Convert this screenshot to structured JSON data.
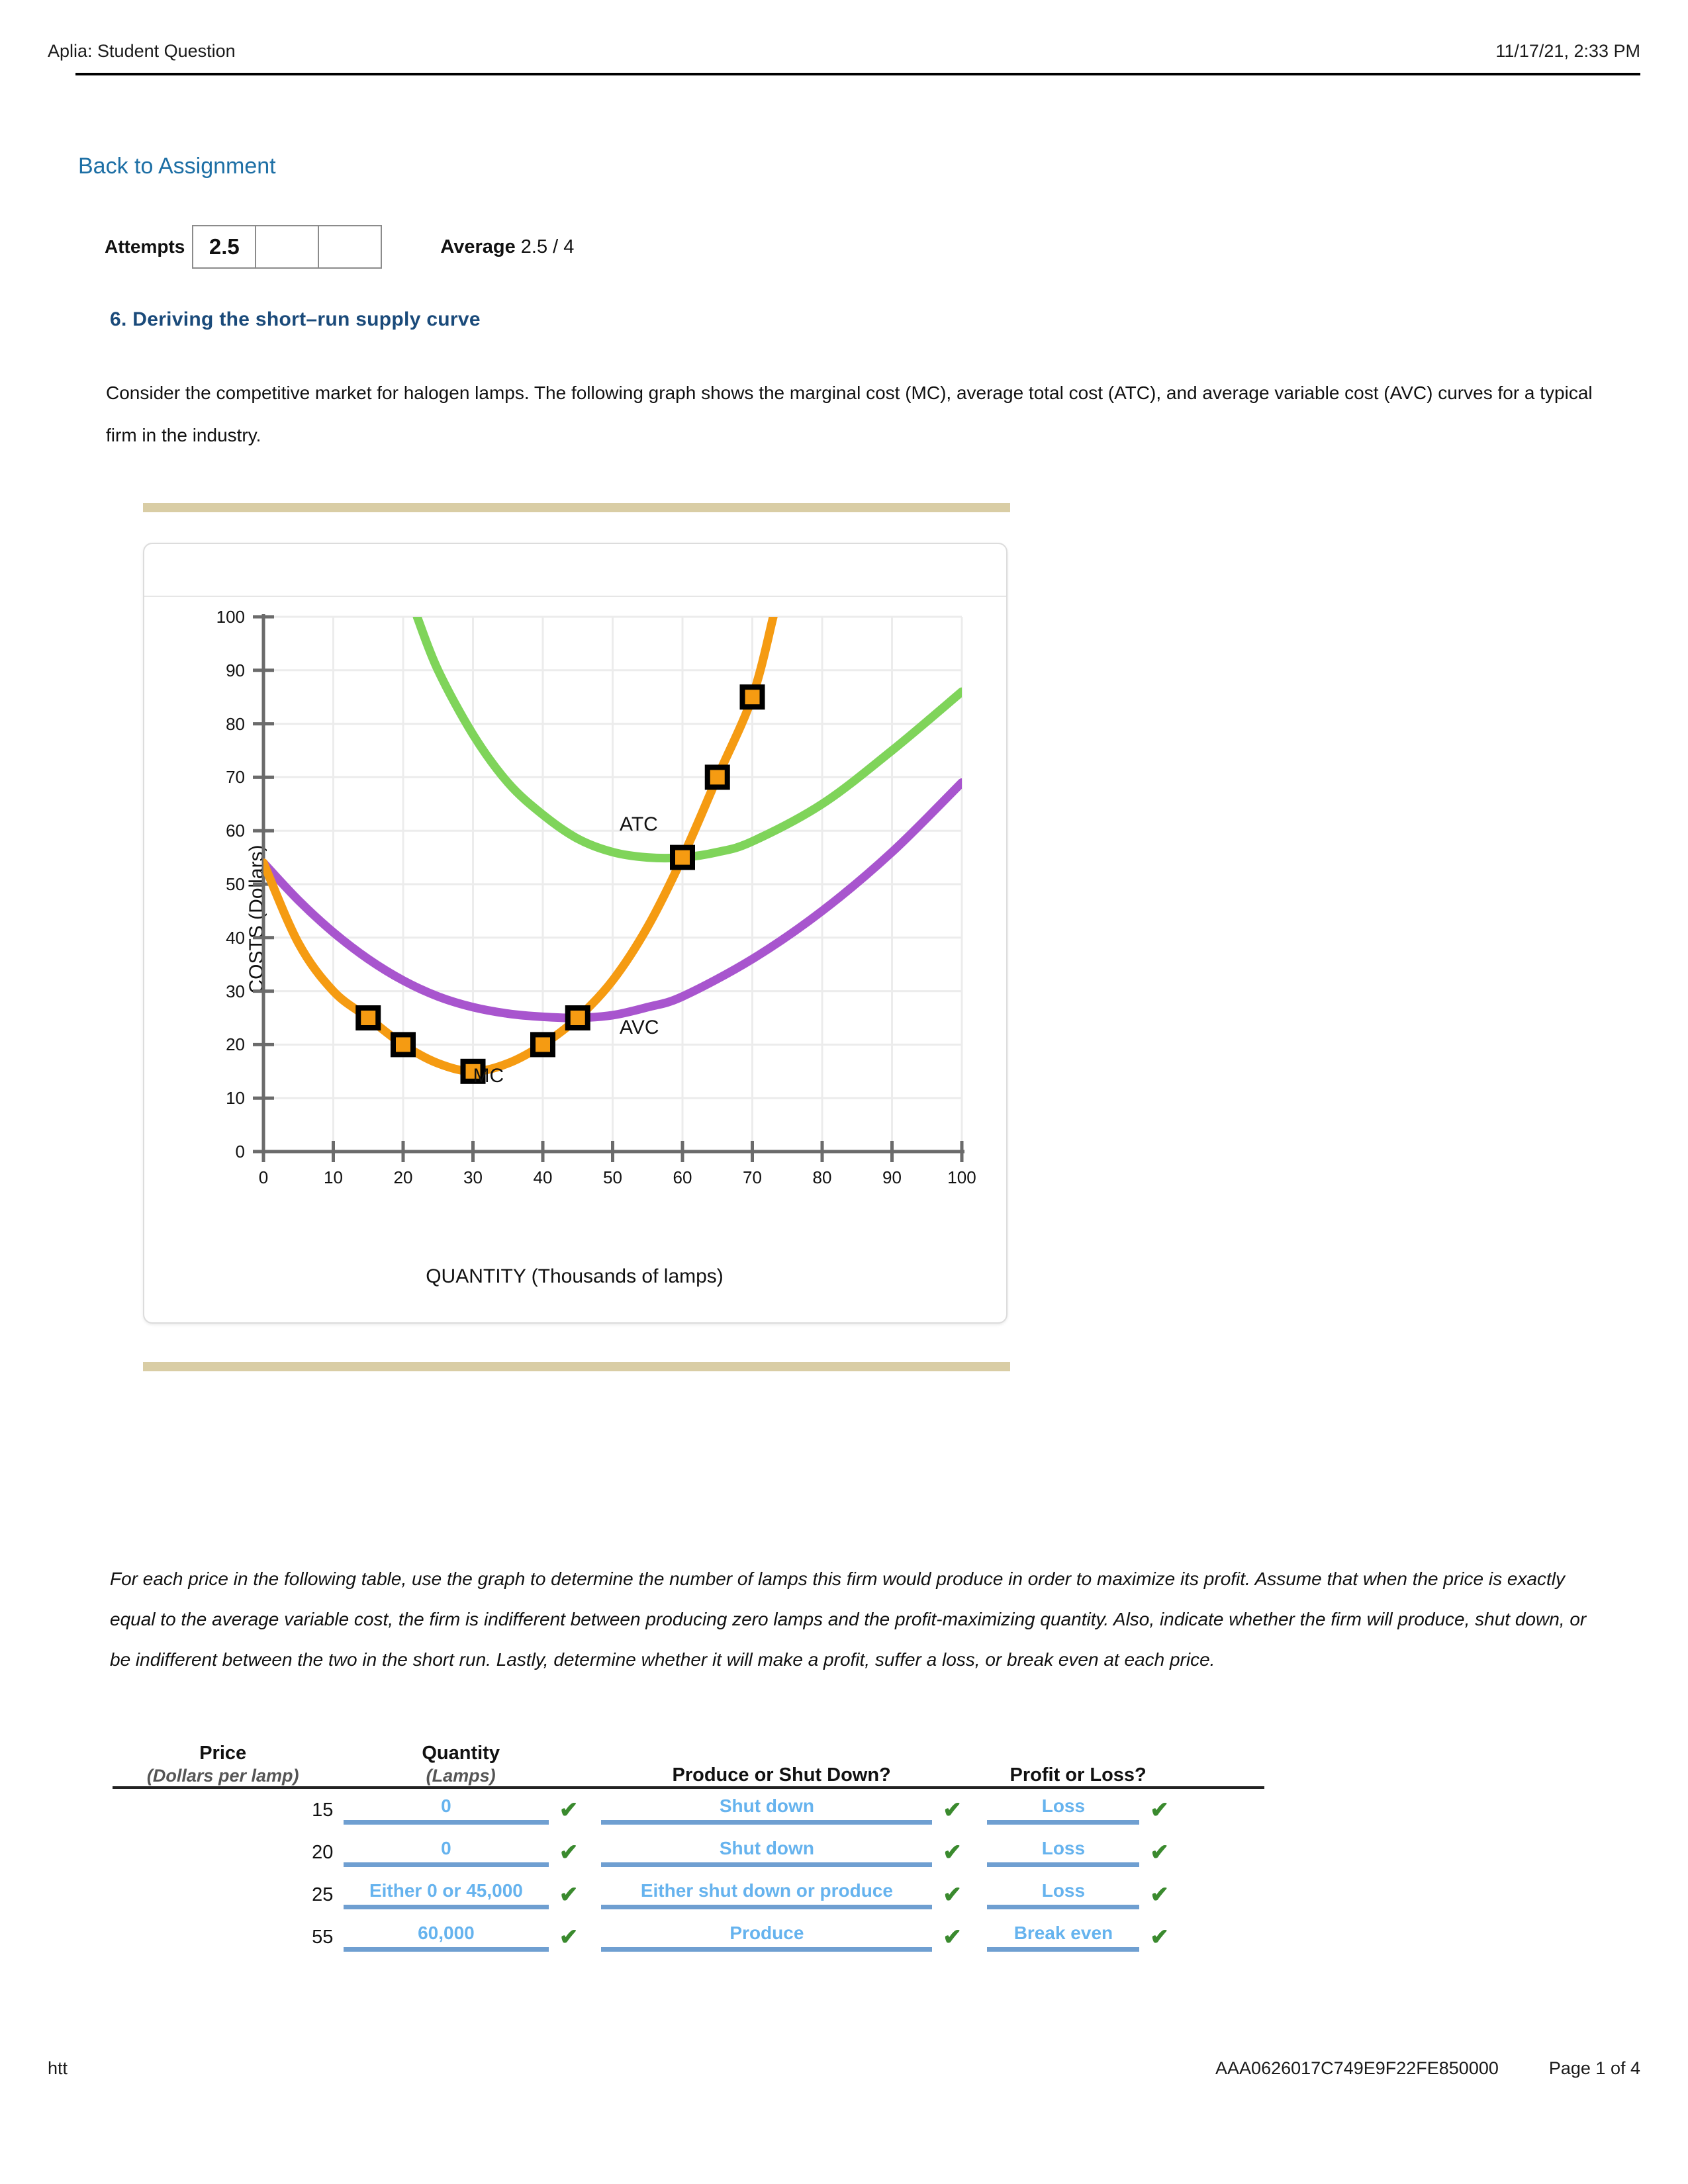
{
  "header": {
    "title": "Aplia: Student Question",
    "timestamp": "11/17/21, 2:33 PM"
  },
  "nav": {
    "back_link": "Back to Assignment"
  },
  "attempts": {
    "label": "Attempts",
    "boxes": [
      "2.5",
      "",
      ""
    ],
    "average_label": "Average",
    "average_value": "2.5 / 4"
  },
  "question": {
    "title": "6. Deriving the short–run supply curve",
    "intro": "Consider the competitive market for halogen lamps. The following graph shows the marginal cost (MC), average total cost (ATC), and average variable cost (AVC) curves for a typical firm in the industry.",
    "instructions": "For each price in the following table, use the graph to determine the number of lamps this firm would produce in order to maximize its profit. Assume that when the price is exactly equal to the average variable cost, the firm is indifferent between producing zero lamps and the profit-maximizing quantity. Also, indicate whether the firm will produce, shut down, or be indifferent between the two in the short run. Lastly, determine whether it will make a profit, suffer a loss, or break even at each price."
  },
  "chart_data": {
    "type": "line",
    "title": "",
    "xlabel": "QUANTITY (Thousands of lamps)",
    "ylabel": "COSTS (Dollars)",
    "xlim": [
      0,
      100
    ],
    "ylim": [
      0,
      100
    ],
    "xticks": [
      0,
      10,
      20,
      30,
      40,
      50,
      60,
      70,
      80,
      90,
      100
    ],
    "yticks": [
      0,
      10,
      20,
      30,
      40,
      50,
      60,
      70,
      80,
      90,
      100
    ],
    "grid": true,
    "legend": "inline-labels",
    "colors": {
      "MC": "#F59B12",
      "ATC": "#7FD45A",
      "AVC": "#A855CE",
      "marker_fill": "#F59B12",
      "marker_stroke": "#000000",
      "axis": "#6b6b6b",
      "grid": "#ececec"
    },
    "series": [
      {
        "name": "MC",
        "label": "MC",
        "color": "#F59B12",
        "label_x": 30,
        "label_y": 13,
        "points": [
          {
            "x": 0,
            "y": 54
          },
          {
            "x": 5,
            "y": 39
          },
          {
            "x": 10,
            "y": 30
          },
          {
            "x": 15,
            "y": 25
          },
          {
            "x": 20,
            "y": 20
          },
          {
            "x": 25,
            "y": 16.5
          },
          {
            "x": 30,
            "y": 15
          },
          {
            "x": 35,
            "y": 16.5
          },
          {
            "x": 40,
            "y": 20
          },
          {
            "x": 45,
            "y": 25
          },
          {
            "x": 50,
            "y": 32
          },
          {
            "x": 55,
            "y": 42
          },
          {
            "x": 60,
            "y": 55
          },
          {
            "x": 65,
            "y": 70
          },
          {
            "x": 70,
            "y": 85
          },
          {
            "x": 73,
            "y": 100
          }
        ],
        "markers": [
          {
            "x": 15,
            "y": 25
          },
          {
            "x": 20,
            "y": 20
          },
          {
            "x": 30,
            "y": 15
          },
          {
            "x": 40,
            "y": 20
          },
          {
            "x": 45,
            "y": 25
          },
          {
            "x": 60,
            "y": 55
          },
          {
            "x": 65,
            "y": 70
          },
          {
            "x": 70,
            "y": 85
          }
        ]
      },
      {
        "name": "ATC",
        "label": "ATC",
        "color": "#7FD45A",
        "label_x": 51,
        "label_y": 60,
        "points": [
          {
            "x": 22,
            "y": 100
          },
          {
            "x": 25,
            "y": 90
          },
          {
            "x": 30,
            "y": 78
          },
          {
            "x": 35,
            "y": 69
          },
          {
            "x": 40,
            "y": 63
          },
          {
            "x": 45,
            "y": 58.5
          },
          {
            "x": 50,
            "y": 56
          },
          {
            "x": 55,
            "y": 55
          },
          {
            "x": 60,
            "y": 55
          },
          {
            "x": 65,
            "y": 56
          },
          {
            "x": 70,
            "y": 58
          },
          {
            "x": 80,
            "y": 65
          },
          {
            "x": 90,
            "y": 75
          },
          {
            "x": 100,
            "y": 86
          }
        ],
        "markers": []
      },
      {
        "name": "AVC",
        "label": "AVC",
        "color": "#A855CE",
        "label_x": 51,
        "label_y": 22,
        "points": [
          {
            "x": 0,
            "y": 54
          },
          {
            "x": 5,
            "y": 47
          },
          {
            "x": 10,
            "y": 41
          },
          {
            "x": 15,
            "y": 36
          },
          {
            "x": 20,
            "y": 32
          },
          {
            "x": 25,
            "y": 29
          },
          {
            "x": 30,
            "y": 27
          },
          {
            "x": 35,
            "y": 25.8
          },
          {
            "x": 40,
            "y": 25.2
          },
          {
            "x": 45,
            "y": 25
          },
          {
            "x": 50,
            "y": 25.5
          },
          {
            "x": 55,
            "y": 27
          },
          {
            "x": 60,
            "y": 29
          },
          {
            "x": 70,
            "y": 36
          },
          {
            "x": 80,
            "y": 45
          },
          {
            "x": 90,
            "y": 56
          },
          {
            "x": 100,
            "y": 69
          }
        ],
        "markers": []
      }
    ]
  },
  "table": {
    "headers": {
      "price_top": "Price",
      "price_sub": "(Dollars per lamp)",
      "quantity_top": "Quantity",
      "quantity_sub": "(Lamps)",
      "produce": "Produce or Shut Down?",
      "profit": "Profit or Loss?"
    },
    "check_glyph": "✔",
    "rows": [
      {
        "price": "15",
        "quantity": "0",
        "produce": "Shut down",
        "profit": "Loss"
      },
      {
        "price": "20",
        "quantity": "0",
        "produce": "Shut down",
        "profit": "Loss"
      },
      {
        "price": "25",
        "quantity": "Either 0 or 45,000",
        "produce": "Either shut down or produce",
        "profit": "Loss"
      },
      {
        "price": "55",
        "quantity": "60,000",
        "produce": "Produce",
        "profit": "Break even"
      }
    ]
  },
  "footer": {
    "left": "htt",
    "code": "AAA0626017C749E9F22FE850000",
    "page": "Page 1 of 4"
  }
}
